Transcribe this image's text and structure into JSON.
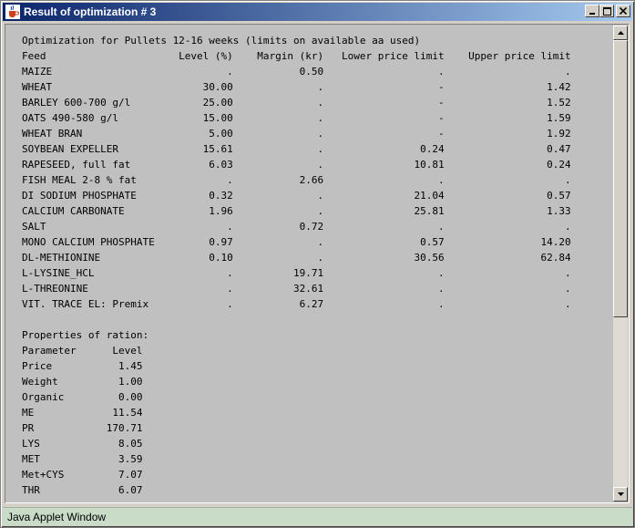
{
  "window": {
    "title": "Result of optimization # 3",
    "status": "Java Applet Window",
    "icon": "java-cup-icon"
  },
  "controls": {
    "minimize": "minimize-icon",
    "maximize": "maximize-icon",
    "close": "close-icon"
  },
  "report": {
    "lines": [
      "Optimization for Pullets 12-16 weeks (limits on available aa used)",
      "Feed                      Level (%)    Margin (kr)   Lower price limit    Upper price limit",
      "MAIZE                             .           0.50                   .                    .",
      "WHEAT                         30.00              .                   -                 1.42",
      "BARLEY 600-700 g/l            25.00              .                   -                 1.52",
      "OATS 490-580 g/l              15.00              .                   -                 1.59",
      "WHEAT BRAN                     5.00              .                   -                 1.92",
      "SOYBEAN EXPELLER              15.61              .                0.24                 0.47",
      "RAPESEED, full fat             6.03              .               10.81                 0.24",
      "FISH MEAL 2-8 % fat               .           2.66                   .                    .",
      "DI SODIUM PHOSPHATE            0.32              .               21.04                 0.57",
      "CALCIUM CARBONATE              1.96              .               25.81                 1.33",
      "SALT                              .           0.72                   .                    .",
      "MONO CALCIUM PHOSPHATE         0.97              .                0.57                14.20",
      "DL-METHIONINE                  0.10              .               30.56                62.84",
      "L-LYSINE_HCL                      .          19.71                   .                    .",
      "L-THREONINE                       .          32.61                   .                    .",
      "VIT. TRACE EL: Premix             .           6.27                   .                    .",
      "",
      "Properties of ration:",
      "Parameter      Level",
      "Price           1.45",
      "Weight          1.00",
      "Organic         0.00",
      "ME             11.54",
      "PR            170.71",
      "LYS             8.05",
      "MET             3.59",
      "Met+CYS         7.07",
      "THR             6.07"
    ]
  },
  "scrollbar": {
    "position": 0.0,
    "visible_fraction": 0.62
  }
}
